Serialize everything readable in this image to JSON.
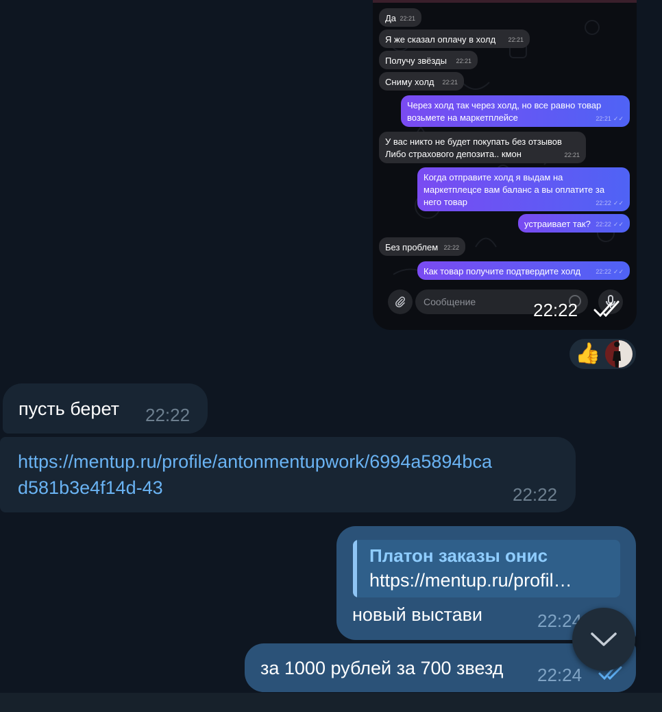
{
  "screenshot": {
    "messages": [
      {
        "side": "in",
        "text": "Да",
        "time": "22:21"
      },
      {
        "side": "in",
        "text": "Я же сказал оплачу в холд",
        "time": "22:21"
      },
      {
        "side": "in",
        "text": "Получу звёзды",
        "time": "22:21"
      },
      {
        "side": "in",
        "text": "Сниму холд",
        "time": "22:21"
      },
      {
        "side": "out",
        "lines": [
          "Через холд так через холд, но все равно товар",
          "возьмете на маркетплейсе"
        ],
        "time": "22:21"
      },
      {
        "side": "in",
        "lines": [
          "У вас никто не будет покупать без отзывов",
          "Либо страхового депозита.. кмон"
        ],
        "time": "22:21"
      },
      {
        "side": "out",
        "lines": [
          "Когда отправите холд я выдам на",
          "маркетплецсе вам баланс а вы оплатите за",
          "него товар"
        ],
        "time": "22:22"
      },
      {
        "side": "out",
        "text": "устраивает так?",
        "time": "22:22"
      },
      {
        "side": "in",
        "text": "Без проблем",
        "time": "22:22"
      },
      {
        "side": "out",
        "text": "Как товар получите подтвердите холд",
        "time": "22:22"
      }
    ],
    "input_placeholder": "Сообщение",
    "time": "22:22",
    "check": "✓✓"
  },
  "reactions": {
    "emoji": "👍"
  },
  "chat": {
    "msg1": {
      "text": "пусть берет",
      "time": "22:22"
    },
    "msg2": {
      "lines": [
        "https://mentup.ru/profile/antonmentupwork/6994a5894bca",
        "d581b3e4f14d-43"
      ],
      "time": "22:22"
    },
    "msg3": {
      "reply_name": "Платон заказы онис",
      "reply_text": "https://mentup.ru/profil…",
      "text": "новый выстави",
      "time": "22:24"
    },
    "msg4": {
      "text": "за 1000 рублей за 700 звезд",
      "time": "22:24"
    }
  },
  "colors": {
    "background": "#0e1621",
    "incoming": "#182533",
    "outgoing": "#2b5278",
    "link": "#6ab3f3",
    "accent_outgoing_gradient": [
      "#7a4bf2",
      "#4f63f5"
    ]
  }
}
